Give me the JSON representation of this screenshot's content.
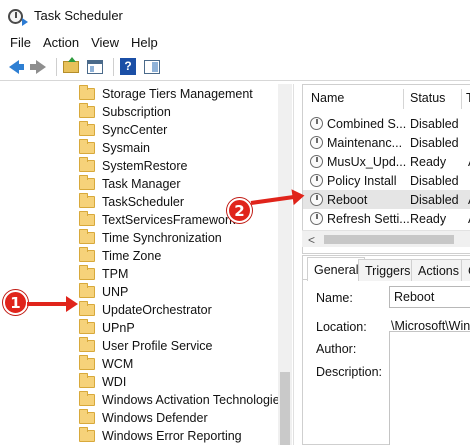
{
  "window": {
    "title": "Task Scheduler",
    "icon": "task-scheduler-icon"
  },
  "menu": [
    "File",
    "Action",
    "View",
    "Help"
  ],
  "toolbar": {
    "buttons": [
      "back-icon",
      "forward-icon",
      "up-folder-icon",
      "show-console-tree-icon",
      "help-icon",
      "show-action-pane-icon"
    ],
    "help_glyph": "?"
  },
  "tree": {
    "items": [
      "Storage Tiers Management",
      "Subscription",
      "SyncCenter",
      "Sysmain",
      "SystemRestore",
      "Task Manager",
      "TaskScheduler",
      "TextServicesFramework",
      "Time Synchronization",
      "Time Zone",
      "TPM",
      "UNP",
      "UpdateOrchestrator",
      "UPnP",
      "User Profile Service",
      "WCM",
      "WDI",
      "Windows Activation Technologie",
      "Windows Defender",
      "Windows Error Reporting"
    ],
    "selected": "UpdateOrchestrator"
  },
  "task_list": {
    "columns": [
      "Name",
      "Status",
      "T"
    ],
    "rows": [
      {
        "name": "Combined S...",
        "status": "Disabled",
        "trigger": ""
      },
      {
        "name": "Maintenanc...",
        "status": "Disabled",
        "trigger": ""
      },
      {
        "name": "MusUx_Upd...",
        "status": "Ready",
        "trigger": "A"
      },
      {
        "name": "Policy Install",
        "status": "Disabled",
        "trigger": ""
      },
      {
        "name": "Reboot",
        "status": "Disabled",
        "trigger": "A"
      },
      {
        "name": "Refresh Setti...",
        "status": "Ready",
        "trigger": "A"
      }
    ],
    "selected": "Reboot",
    "scroll_left_glyph": "<"
  },
  "details": {
    "tabs": [
      "General",
      "Triggers",
      "Actions",
      "C"
    ],
    "active_tab": "General",
    "name_label": "Name:",
    "name_value": "Reboot",
    "location_label": "Location:",
    "location_value": "\\Microsoft\\Win",
    "author_label": "Author:",
    "description_label": "Description:"
  },
  "annotations": [
    {
      "number": "1",
      "color": "#e0241b"
    },
    {
      "number": "2",
      "color": "#e0241b"
    }
  ]
}
